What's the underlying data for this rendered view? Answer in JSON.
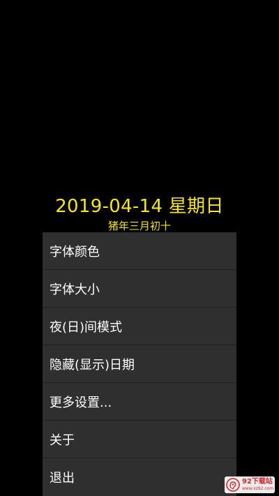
{
  "clock": {
    "date": "2019-04-14 星期日",
    "lunar": "猪年三月初十",
    "color": "#f4e61a"
  },
  "menu": {
    "items": [
      {
        "label": "字体颜色"
      },
      {
        "label": "字体大小"
      },
      {
        "label": "夜(日)间模式"
      },
      {
        "label": "隐藏(显示)日期"
      },
      {
        "label": "更多设置..."
      },
      {
        "label": "关于"
      },
      {
        "label": "退出"
      }
    ],
    "background": "#2f2f2f"
  },
  "watermark": {
    "main": "92下载站",
    "sub": "www.xz92.com",
    "color": "#d0282e"
  }
}
